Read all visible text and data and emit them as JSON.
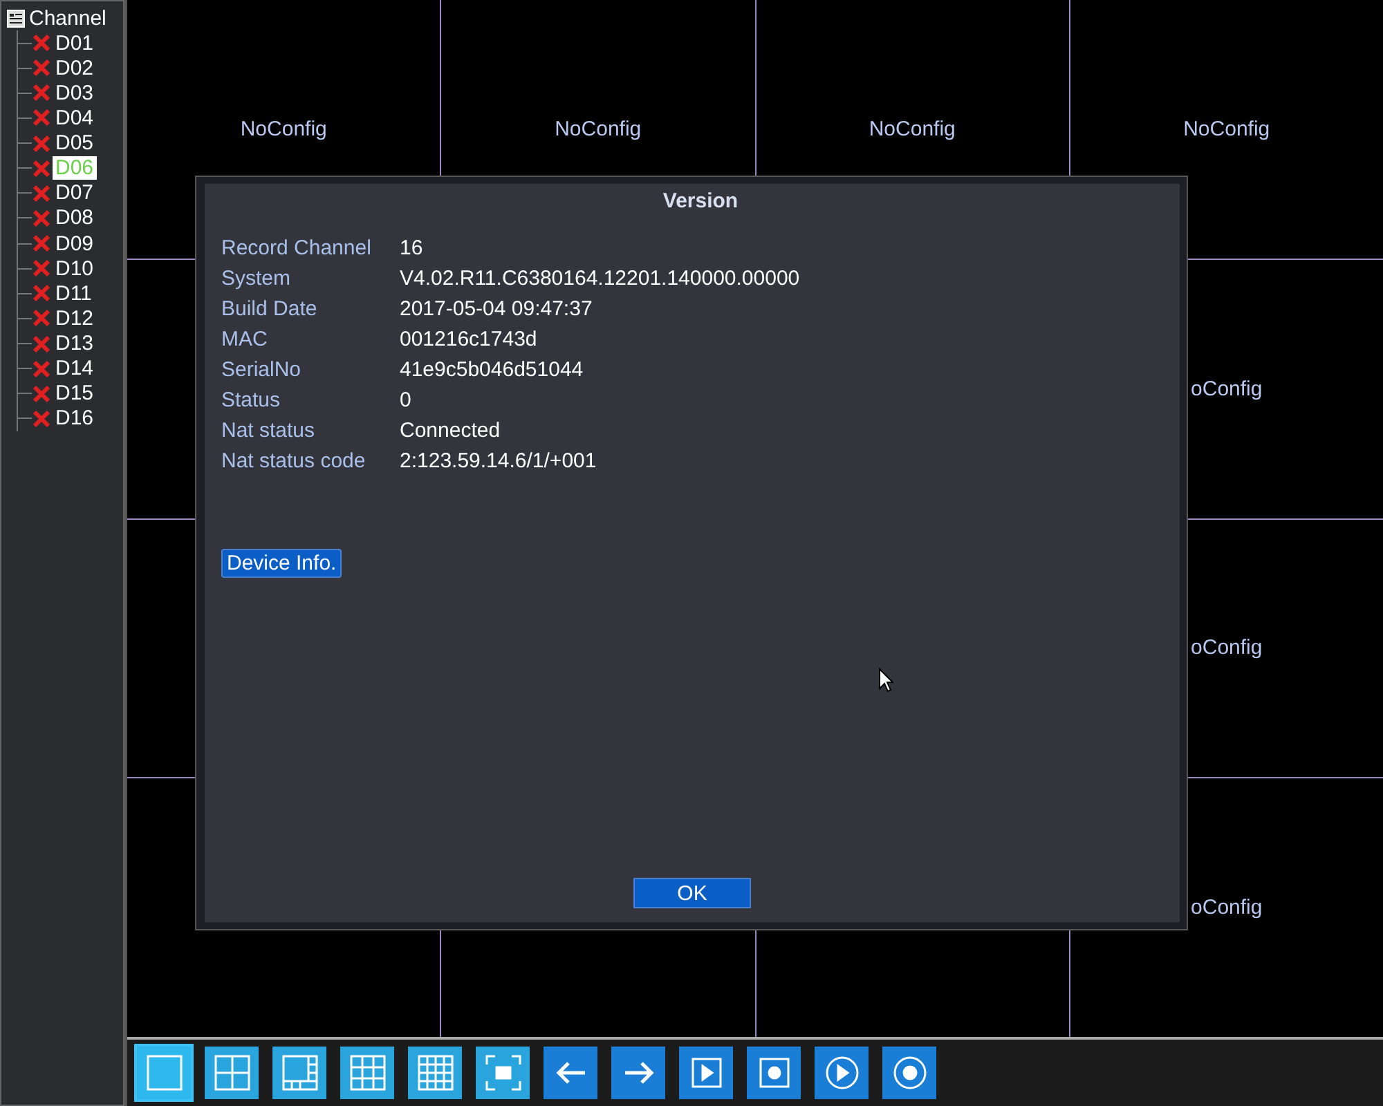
{
  "sidebar": {
    "title": "Channel",
    "items": [
      {
        "label": "D01",
        "selected": false
      },
      {
        "label": "D02",
        "selected": false
      },
      {
        "label": "D03",
        "selected": false
      },
      {
        "label": "D04",
        "selected": false
      },
      {
        "label": "D05",
        "selected": false
      },
      {
        "label": "D06",
        "selected": true
      },
      {
        "label": "D07",
        "selected": false
      },
      {
        "label": "D08",
        "selected": false
      },
      {
        "label": "D09",
        "selected": false
      },
      {
        "label": "D10",
        "selected": false
      },
      {
        "label": "D11",
        "selected": false
      },
      {
        "label": "D12",
        "selected": false
      },
      {
        "label": "D13",
        "selected": false
      },
      {
        "label": "D14",
        "selected": false
      },
      {
        "label": "D15",
        "selected": false
      },
      {
        "label": "D16",
        "selected": false
      }
    ]
  },
  "grid": {
    "cells": [
      {
        "label": "NoConfig"
      },
      {
        "label": "NoConfig"
      },
      {
        "label": "NoConfig"
      },
      {
        "label": "NoConfig"
      },
      {},
      {},
      {},
      {
        "label": "oConfig"
      },
      {},
      {},
      {},
      {
        "label": "oConfig"
      },
      {},
      {},
      {},
      {
        "label": "oConfig"
      }
    ]
  },
  "dialog": {
    "title": "Version",
    "rows": [
      {
        "label": "Record Channel",
        "value": "16"
      },
      {
        "label": "System",
        "value": "V4.02.R11.C6380164.12201.140000.00000"
      },
      {
        "label": "Build Date",
        "value": "2017-05-04 09:47:37"
      },
      {
        "label": "MAC",
        "value": "001216c1743d"
      },
      {
        "label": "SerialNo",
        "value": "41e9c5b046d51044"
      },
      {
        "label": "Status",
        "value": "0"
      },
      {
        "label": "Nat status",
        "value": "Connected"
      },
      {
        "label": "Nat status code",
        "value": "2:123.59.14.6/1/+001"
      }
    ],
    "device_button": "Device Info.",
    "ok_button": "OK"
  },
  "toolbar": {
    "buttons": [
      {
        "kind": "single",
        "selected": true
      },
      {
        "kind": "quad",
        "selected": false
      },
      {
        "kind": "mixed",
        "selected": false
      },
      {
        "kind": "nine",
        "selected": false
      },
      {
        "kind": "sixteen",
        "selected": false
      },
      {
        "kind": "fullscreen",
        "selected": false
      },
      {
        "kind": "prev",
        "selected": false
      },
      {
        "kind": "next",
        "selected": false
      },
      {
        "kind": "play-square",
        "selected": false
      },
      {
        "kind": "record-square",
        "selected": false
      },
      {
        "kind": "play-circle",
        "selected": false
      },
      {
        "kind": "record-circle",
        "selected": false
      }
    ]
  }
}
